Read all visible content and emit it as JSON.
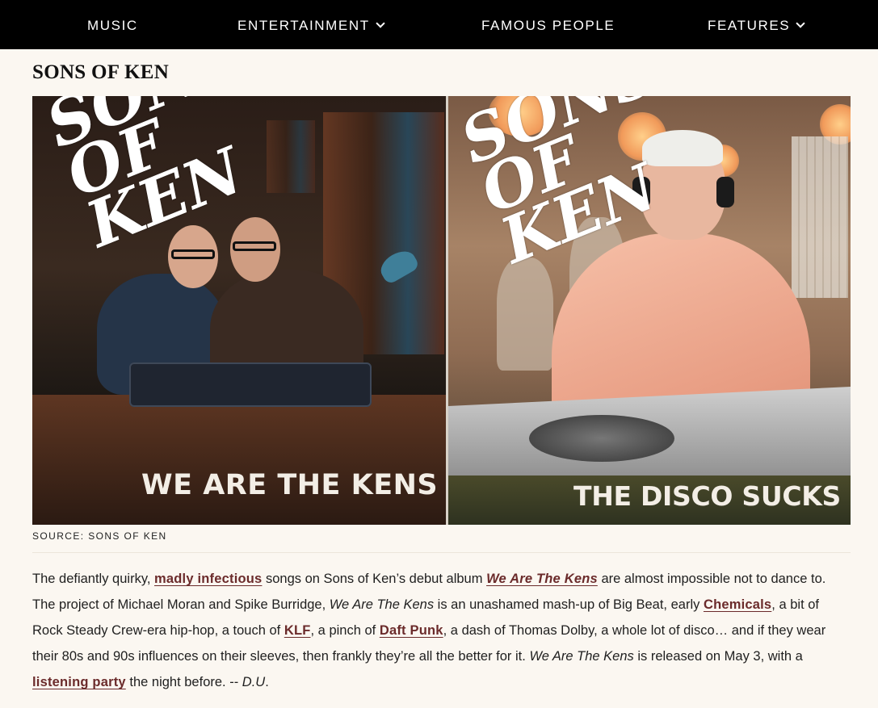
{
  "nav": {
    "items": [
      {
        "label": "MUSIC",
        "has_dropdown": false
      },
      {
        "label": "ENTERTAINMENT",
        "has_dropdown": true
      },
      {
        "label": "FAMOUS PEOPLE",
        "has_dropdown": false
      },
      {
        "label": "FEATURES",
        "has_dropdown": true
      }
    ]
  },
  "article": {
    "title": "SONS OF KEN",
    "hero": {
      "left_cover": {
        "graffiti": [
          "SONS",
          "OF",
          "KEN"
        ],
        "caption": "WE ARE THE KENS"
      },
      "right_cover": {
        "graffiti": [
          "SONS",
          "OF",
          "KEN"
        ],
        "caption": "THE DISCO SUCKS EP"
      }
    },
    "source": "SOURCE: SONS OF KEN",
    "body": {
      "t1": "The defiantly quirky, ",
      "l1": "madly infectious",
      "t2": " songs on Sons of Ken’s debut album ",
      "l2": "We Are The Kens",
      "t3": " are almost impossible not to dance to. The project of Michael Moran and Spike Burridge, ",
      "e1": "We Are The Kens",
      "t4": " is an unashamed mash-up of Big Beat, early ",
      "l3": "Chemicals",
      "t5": ", a bit of Rock Steady Crew-era hip-hop, a touch of ",
      "l4": "KLF",
      "t6": ", a pinch of ",
      "l5": "Daft Punk",
      "t7": ", a dash of Thomas Dolby, a whole lot of disco… and if they wear their 80s and 90s influences on their sleeves, then frankly they’re all the better for it. ",
      "e2": "We Are The Kens",
      "t8": " is released on May 3, with a ",
      "l6": "listening party",
      "t9": " the night before. -- ",
      "e3": "D.U",
      "t10": "."
    }
  },
  "colors": {
    "nav_bg": "#000000",
    "page_bg": "#fbf7f1",
    "link": "#6b2b2b"
  }
}
